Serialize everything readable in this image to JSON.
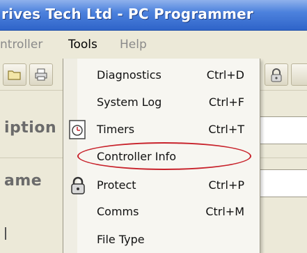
{
  "window": {
    "title": "rives Tech Ltd - PC Programmer"
  },
  "menubar": {
    "items": [
      {
        "label": "ntroller"
      },
      {
        "label": "Tools"
      },
      {
        "label": "Help"
      }
    ]
  },
  "form": {
    "description_label": "iption",
    "name_label": "ame"
  },
  "tools_menu": {
    "items": [
      {
        "label": "Diagnostics",
        "shortcut": "Ctrl+D",
        "icon": ""
      },
      {
        "label": "System Log",
        "shortcut": "Ctrl+F",
        "icon": ""
      },
      {
        "label": "Timers",
        "shortcut": "Ctrl+T",
        "icon": "timer-icon"
      },
      {
        "label": "Controller Info",
        "shortcut": "",
        "icon": "",
        "highlighted": true
      },
      {
        "label": "Protect",
        "shortcut": "Ctrl+P",
        "icon": "padlock-icon"
      },
      {
        "label": "Comms",
        "shortcut": "Ctrl+M",
        "icon": ""
      },
      {
        "label": "File Type",
        "shortcut": "",
        "icon": ""
      }
    ],
    "highlight_color": "#c8222b"
  },
  "colors": {
    "titlebar": "#3a6fd0",
    "menu_background": "#f7f6f1",
    "window_background": "#ece9d8"
  }
}
